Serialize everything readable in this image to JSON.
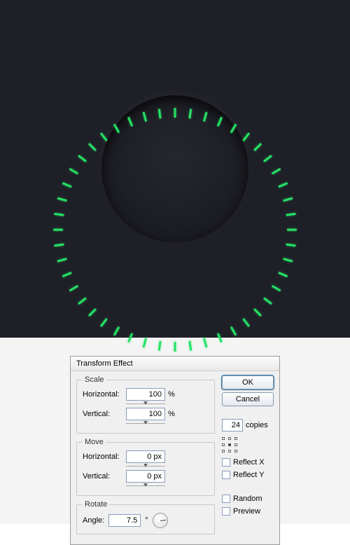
{
  "canvas": {
    "bg": "#1f1f28",
    "tick_color": "#25e265",
    "tick_count": 48,
    "tick_radius": 80
  },
  "dialog": {
    "title": "Transform Effect",
    "scale": {
      "legend": "Scale",
      "h_label": "Horizontal:",
      "h_value": "100",
      "v_label": "Vertical:",
      "v_value": "100",
      "unit": "%"
    },
    "move": {
      "legend": "Move",
      "h_label": "Horizontal:",
      "h_value": "0 px",
      "v_label": "Vertical:",
      "v_value": "0 px"
    },
    "rotate": {
      "legend": "Rotate",
      "angle_label": "Angle:",
      "angle_value": "7.5",
      "angle_unit": "°"
    },
    "buttons": {
      "ok": "OK",
      "cancel": "Cancel"
    },
    "copies": {
      "value": "24",
      "label": "copies"
    },
    "options": {
      "reflect_x": "Reflect X",
      "reflect_y": "Reflect Y",
      "random": "Random",
      "preview": "Preview"
    }
  }
}
